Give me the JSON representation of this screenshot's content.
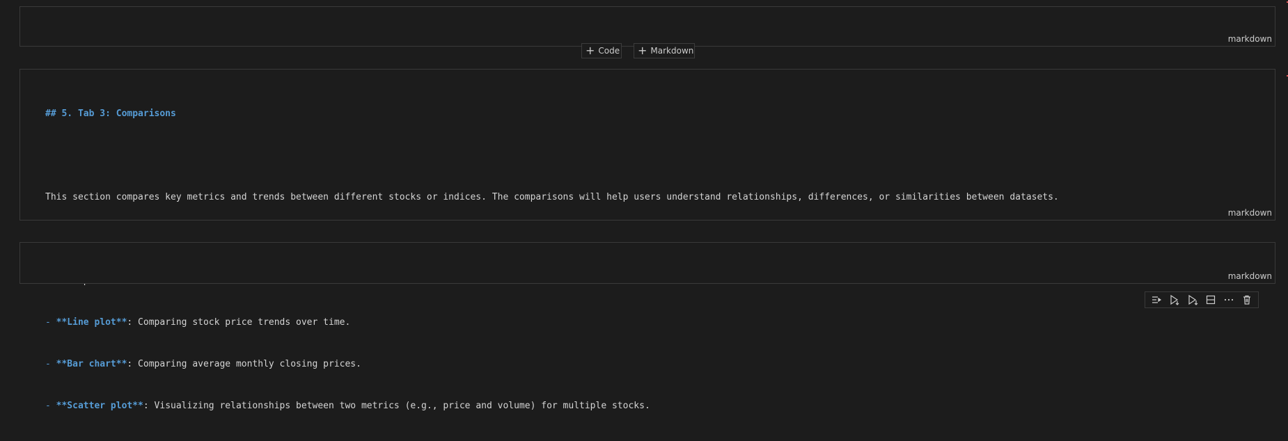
{
  "cells": {
    "top": {
      "language": "markdown"
    },
    "middle": {
      "language": "markdown",
      "heading": "## 5. Tab 3: Comparisons",
      "paragraph": "This section compares key metrics and trends between different stocks or indices. The comparisons will help users understand relationships, differences, or similarities between datasets.",
      "intro": "The comparisons include:",
      "items": [
        {
          "prefix": "- ",
          "bold": "**Line plot**",
          "text": ": Comparing stock price trends over time."
        },
        {
          "prefix": "- ",
          "bold": "**Bar chart**",
          "text": ": Comparing average monthly closing prices."
        },
        {
          "prefix": "- ",
          "bold": "**Scatter plot**",
          "text": ": Visualizing relationships between two metrics (e.g., price and volume) for multiple stocks."
        }
      ]
    },
    "bottom": {
      "language": "markdown"
    }
  },
  "add_cell": {
    "code_label": "Code",
    "markdown_label": "Markdown"
  },
  "toolbar": {
    "icons": [
      "run-by-line-icon",
      "execute-above-icon",
      "execute-below-icon",
      "split-cell-icon",
      "more-icon",
      "delete-icon"
    ]
  }
}
